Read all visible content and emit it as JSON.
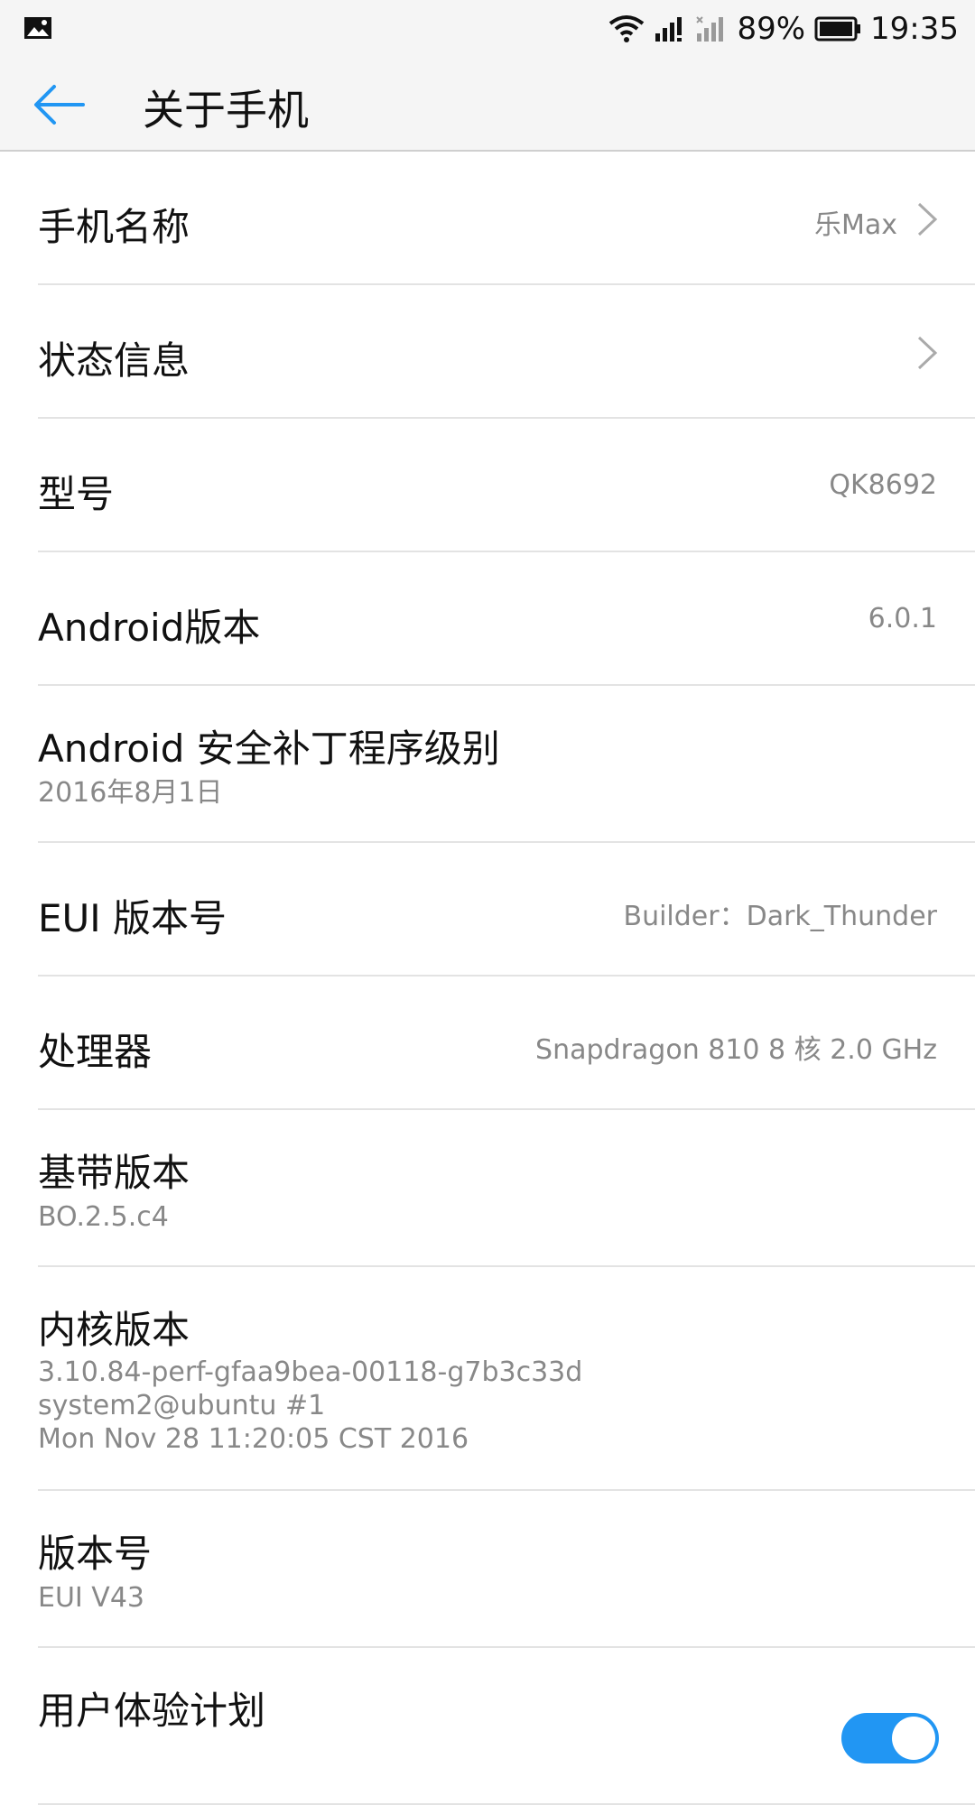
{
  "status_bar": {
    "battery_percent": "89%",
    "time": "19:35",
    "icons": [
      "image-icon",
      "wifi-icon",
      "signal-icon",
      "signal-no-sim-icon",
      "battery-icon"
    ]
  },
  "header": {
    "title": "关于手机"
  },
  "rows": [
    {
      "label": "手机名称",
      "value": "乐Max"
    },
    {
      "label": "状态信息"
    },
    {
      "label": "型号",
      "value": "QK8692"
    },
    {
      "label": "Android版本",
      "value": "6.0.1"
    },
    {
      "label": "Android 安全补丁程序级别",
      "sub": "2016年8月1日"
    },
    {
      "label": "EUI 版本号",
      "value": "Builder：Dark_Thunder"
    },
    {
      "label": "处理器",
      "value": "Snapdragon 810 8 核 2.0 GHz"
    },
    {
      "label": "基带版本",
      "sub": "BO.2.5.c4"
    },
    {
      "label": "内核版本",
      "sub_lines": [
        "3.10.84-perf-gfaa9bea-00118-g7b3c33d",
        "system2@ubuntu #1",
        "Mon Nov 28 11:20:05 CST 2016"
      ]
    },
    {
      "label": "版本号",
      "sub": "EUI V43"
    },
    {
      "label": "用户体验计划",
      "toggle_on": true
    }
  ],
  "colors": {
    "accent": "#2196f3",
    "secondary_text": "#888888",
    "divider": "#e3e3e3"
  }
}
